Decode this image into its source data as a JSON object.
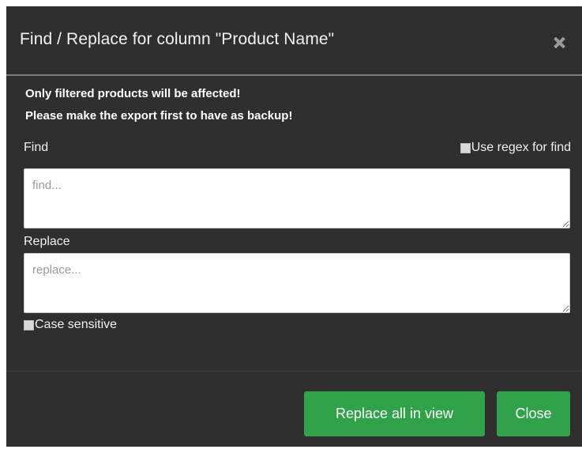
{
  "dialog": {
    "title": "Find / Replace for column \"Product Name\"",
    "close_icon": "close-icon"
  },
  "warnings": {
    "line1": "Only filtered products will be affected!",
    "line2": "Please make the export first to have as backup!"
  },
  "find": {
    "label": "Find",
    "placeholder": "find...",
    "value": "",
    "use_regex_label": "Use regex for find",
    "use_regex_checked": false
  },
  "replace": {
    "label": "Replace",
    "placeholder": "replace...",
    "value": "",
    "case_sensitive_label": "Case sensitive",
    "case_sensitive_checked": false
  },
  "footer": {
    "replace_all_label": "Replace all in view",
    "close_label": "Close"
  },
  "colors": {
    "modal_bg": "#2f2f2f",
    "button_green": "#2fa24a"
  }
}
